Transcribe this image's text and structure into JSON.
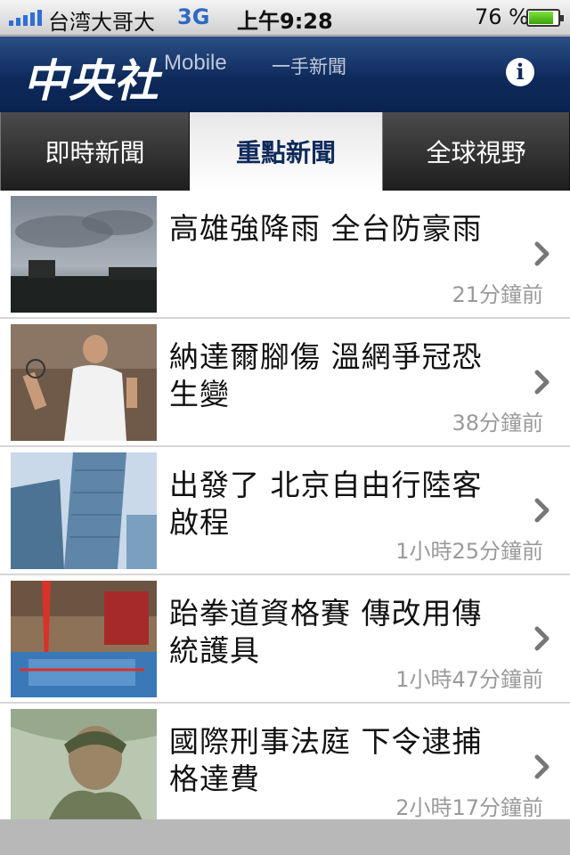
{
  "status_bar": {
    "carrier": "台湾大哥大",
    "network": "3G",
    "time": "上午9:28",
    "battery": "76 %"
  },
  "header": {
    "logo": "中央社",
    "subtitle": "Mobile",
    "tagline": "一手新聞",
    "info_icon": "info-icon"
  },
  "tabs": [
    {
      "label": "即時新聞"
    },
    {
      "label": "重點新聞"
    },
    {
      "label": "全球視野"
    }
  ],
  "news": [
    {
      "title": "高雄強降雨 全台防豪雨",
      "time": "21分鐘前"
    },
    {
      "title": "納達爾腳傷 溫網爭冠恐生變",
      "time": "38分鐘前"
    },
    {
      "title": "出發了 北京自由行陸客啟程",
      "time": "1小時25分鐘前"
    },
    {
      "title": "跆拳道資格賽 傳改用傳統護具",
      "time": "1小時47分鐘前"
    },
    {
      "title": "國際刑事法庭 下令逮捕格達費",
      "time": "2小時17分鐘前"
    }
  ],
  "colors": {
    "header_navy": "#0e2a5b",
    "time_gray": "#9a9a9a"
  }
}
